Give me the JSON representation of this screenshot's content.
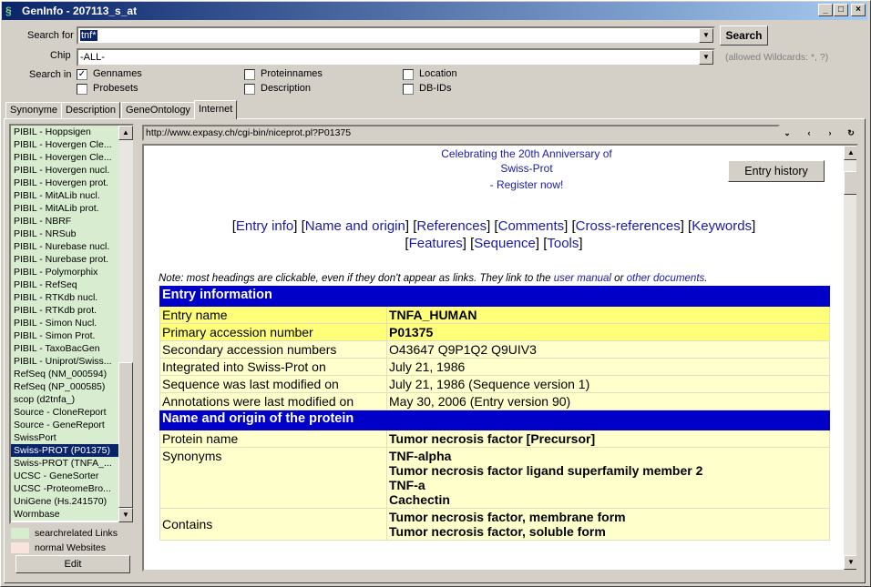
{
  "window": {
    "title": "GenInfo - 207113_s_at",
    "min": "_",
    "max": "□",
    "close": "×"
  },
  "search": {
    "label": "Search for",
    "value": "tnf*",
    "button": "Search"
  },
  "chip": {
    "label": "Chip",
    "value": "-ALL-",
    "hint": "(allowed Wildcards: *, ?)"
  },
  "searchin": {
    "label": "Search in",
    "options": [
      {
        "label": "Gennames",
        "checked": true
      },
      {
        "label": "Proteinnames",
        "checked": false
      },
      {
        "label": "Location",
        "checked": false
      },
      {
        "label": "Probesets",
        "checked": false
      },
      {
        "label": "Description",
        "checked": false
      },
      {
        "label": "DB-IDs",
        "checked": false
      }
    ]
  },
  "tabs": [
    "Synonyme",
    "Description",
    "GeneOntology",
    "Internet"
  ],
  "links": [
    "PIBIL - Hoppsigen",
    "PIBIL - Hovergen Cle...",
    "PIBIL - Hovergen Cle...",
    "PIBIL - Hovergen nucl.",
    "PIBIL - Hovergen prot.",
    "PIBIL - MitALib nucl.",
    "PIBIL - MitALib prot.",
    "PIBIL - NBRF",
    "PIBIL - NRSub",
    "PIBIL - Nurebase nucl.",
    "PIBIL - Nurebase prot.",
    "PIBIL - Polymorphix",
    "PIBIL - RefSeq",
    "PIBIL - RTKdb nucl.",
    "PIBIL - RTKdb prot.",
    "PIBIL - Simon Nucl.",
    "PIBIL - Simon Prot.",
    "PIBIL - TaxoBacGen",
    "PIBIL - Uniprot/Swiss...",
    "RefSeq (NM_000594)",
    "RefSeq (NP_000585)",
    "scop (d2tnfa_)",
    "Source - CloneReport",
    "Source - GeneReport",
    "SwissPort",
    "Swiss-PROT (P01375)",
    "Swiss-PROT (TNFA_...",
    "UCSC - GeneSorter",
    "UCSC -ProteomeBro...",
    "UniGene (Hs.241570)",
    "Wormbase"
  ],
  "legend": {
    "related": "searchrelated Links",
    "normal": "normal Websites",
    "edit": "Edit"
  },
  "url": "http://www.expasy.ch/cgi-bin/niceprot.pl?P01375",
  "nav": {
    "down": "⌄",
    "back": "‹",
    "fwd": "›",
    "refresh": "↻"
  },
  "web": {
    "banner1": "Celebrating the 20th Anniversary of",
    "banner2": "Swiss-Prot",
    "banner3": "- Register now!",
    "history_btn": "Entry history",
    "links": [
      "Entry info",
      "Name and origin",
      "References",
      "Comments",
      "Cross-references",
      "Keywords",
      "Features",
      "Sequence",
      "Tools"
    ],
    "note_a": "Note: most headings are clickable, even if they don't appear as links. They link to the ",
    "note_link1": "user manual",
    "note_b": " or ",
    "note_link2": "other documents",
    "note_c": ".",
    "sec1": "Entry information",
    "rows1": [
      {
        "k": "Entry name",
        "v": "TNFA_HUMAN"
      },
      {
        "k": "Primary accession number",
        "v": "P01375"
      },
      {
        "k": "Secondary accession numbers",
        "v": "O43647 Q9P1Q2 Q9UIV3"
      },
      {
        "k": "Integrated into Swiss-Prot on",
        "v": "July 21, 1986"
      },
      {
        "k": "Sequence was last modified on",
        "v": "July 21, 1986 (Sequence version 1)"
      },
      {
        "k": "Annotations were last modified on",
        "v": "May 30, 2006 (Entry version 90)"
      }
    ],
    "sec2": "Name and origin of the protein",
    "protein_name_k": "Protein name",
    "protein_name_v": "Tumor necrosis factor [Precursor]",
    "synonyms_k": "Synonyms",
    "synonyms": [
      "TNF-alpha",
      "Tumor necrosis factor ligand superfamily member 2",
      "TNF-a",
      "Cachectin"
    ],
    "contains_k": "Contains",
    "contains": [
      "Tumor necrosis factor, membrane form",
      "Tumor necrosis factor, soluble form"
    ]
  },
  "colors": {
    "related": "#d8ecd0",
    "normal": "#f8e4dc",
    "section": "#0000c8",
    "cell": "#ffffcc",
    "highlight": "#ffff7a"
  }
}
